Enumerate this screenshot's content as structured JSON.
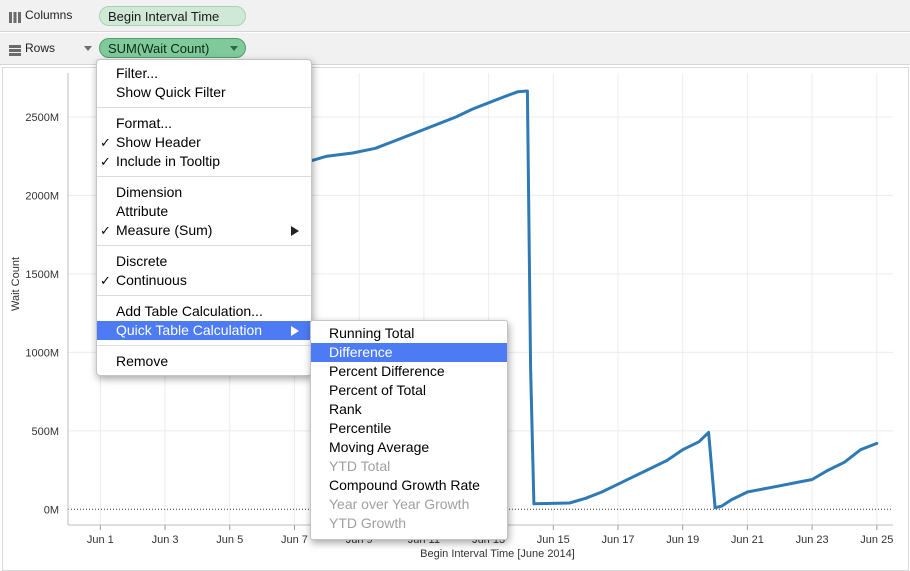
{
  "shelves": {
    "columns": {
      "label": "Columns",
      "pill": "Begin Interval Time"
    },
    "rows": {
      "label": "Rows",
      "pill": "SUM(Wait Count)"
    }
  },
  "colors": {
    "line": "#2f7ab5",
    "menu_highlight": "#4d7bf4",
    "measure_pill": "#7fc99a",
    "dimension_pill": "#cfe9d6"
  },
  "icons": [
    "columns-shelf-icon",
    "rows-shelf-icon",
    "dropdown-arrow-icon",
    "checkmark-icon",
    "submenu-arrow-icon"
  ],
  "context_menu": {
    "items": [
      {
        "label": "Filter..."
      },
      {
        "label": "Show Quick Filter"
      },
      {
        "label": "Format..."
      },
      {
        "label": "Show Header",
        "checked": true
      },
      {
        "label": "Include in Tooltip",
        "checked": true
      },
      {
        "label": "Dimension"
      },
      {
        "label": "Attribute"
      },
      {
        "label": "Measure (Sum)",
        "checked": true,
        "submenu": true
      },
      {
        "label": "Discrete"
      },
      {
        "label": "Continuous",
        "checked": true
      },
      {
        "label": "Add Table Calculation..."
      },
      {
        "label": "Quick Table Calculation",
        "submenu": true,
        "highlighted": true
      },
      {
        "label": "Remove"
      }
    ]
  },
  "quick_table_calc_menu": {
    "items": [
      {
        "label": "Running Total"
      },
      {
        "label": "Difference",
        "highlighted": true
      },
      {
        "label": "Percent Difference"
      },
      {
        "label": "Percent of Total"
      },
      {
        "label": "Rank"
      },
      {
        "label": "Percentile"
      },
      {
        "label": "Moving Average"
      },
      {
        "label": "YTD Total",
        "disabled": true
      },
      {
        "label": "Compound Growth Rate"
      },
      {
        "label": "Year over Year Growth",
        "disabled": true
      },
      {
        "label": "YTD Growth",
        "disabled": true
      }
    ]
  },
  "chart_data": {
    "type": "line",
    "xlabel": "Begin Interval Time [June 2014]",
    "ylabel": "Wait Count",
    "x_ticks": [
      "Jun 1",
      "Jun 3",
      "Jun 5",
      "Jun 7",
      "Jun 9",
      "Jun 11",
      "Jun 13",
      "Jun 15",
      "Jun 17",
      "Jun 19",
      "Jun 21",
      "Jun 23",
      "Jun 25"
    ],
    "y_ticks": [
      "0M",
      "500M",
      "1000M",
      "1500M",
      "2000M",
      "2500M"
    ],
    "xlim": [
      0,
      25.5
    ],
    "ylim": [
      -100,
      2780
    ],
    "grid": true,
    "zero_line": "dotted",
    "series": [
      {
        "x": [
          6.7,
          7.5,
          8.0,
          8.8,
          9.5,
          10.0,
          10.5,
          11.0,
          11.5,
          12.0,
          12.5,
          13.0,
          13.5,
          13.9,
          14.2,
          14.3,
          14.4,
          15.5,
          16.0,
          16.5,
          17.0,
          17.5,
          18.0,
          18.5,
          19.0,
          19.5,
          19.8,
          20.0,
          20.2,
          20.5,
          21.0,
          21.5,
          22.0,
          22.5,
          23.0,
          23.5,
          24.0,
          24.5,
          25.0
        ],
        "y": [
          2200,
          2220,
          2250,
          2270,
          2300,
          2340,
          2380,
          2420,
          2460,
          2500,
          2550,
          2590,
          2630,
          2660,
          2665,
          900,
          35,
          40,
          70,
          110,
          160,
          210,
          260,
          310,
          380,
          430,
          490,
          10,
          20,
          60,
          110,
          130,
          150,
          170,
          190,
          250,
          300,
          380,
          420
        ]
      }
    ]
  }
}
